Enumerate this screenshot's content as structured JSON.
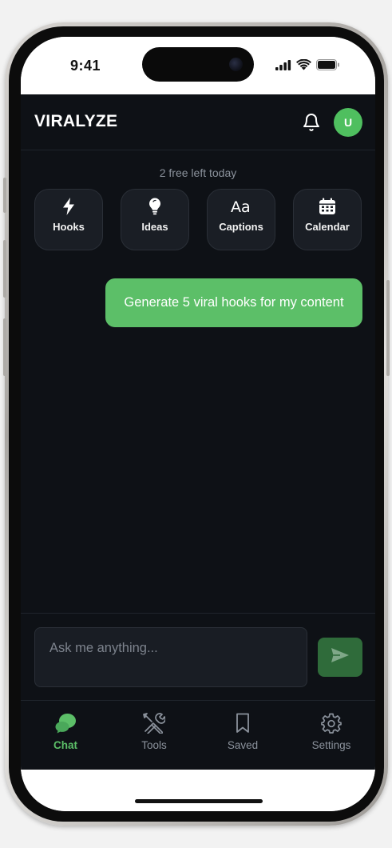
{
  "device": {
    "status_time": "9:41",
    "icons": [
      "cellular-signal-icon",
      "wifi-icon",
      "battery-icon"
    ]
  },
  "header": {
    "brand": "VIRALYZE",
    "notification_icon": "bell-icon",
    "avatar_initial": "U"
  },
  "usage": {
    "free_left": "2 free left today"
  },
  "tools": [
    {
      "label": "Hooks",
      "icon": "lightning-bolt-icon"
    },
    {
      "label": "Ideas",
      "icon": "lightbulb-icon"
    },
    {
      "label": "Captions",
      "icon": "text-aa-icon"
    },
    {
      "label": "Calendar",
      "icon": "calendar-icon"
    }
  ],
  "chat": {
    "messages": [
      {
        "role": "user",
        "text": "Generate 5 viral hooks for my content"
      }
    ]
  },
  "composer": {
    "placeholder": "Ask me anything...",
    "value": "",
    "send_icon": "send-icon"
  },
  "tabbar": {
    "tabs": [
      {
        "label": "Chat",
        "icon": "chat-bubble-icon",
        "active": true
      },
      {
        "label": "Tools",
        "icon": "tools-icon",
        "active": false
      },
      {
        "label": "Saved",
        "icon": "bookmark-icon",
        "active": false
      },
      {
        "label": "Settings",
        "icon": "gear-icon",
        "active": false
      }
    ]
  },
  "colors": {
    "accent": "#5cbf68",
    "background": "#0e1116",
    "card": "#1a1e25",
    "muted_text": "#8b929c",
    "send_button": "#2f6b3a"
  }
}
